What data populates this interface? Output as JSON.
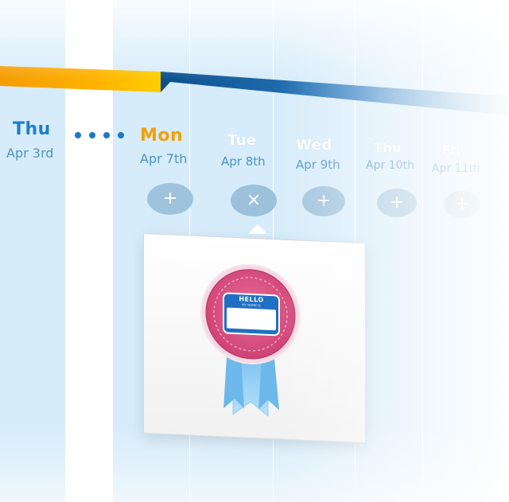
{
  "timeline": {
    "colors": {
      "orange": "#f2a10c",
      "blue": "#0f6eb0",
      "muted": "#4b95c3"
    }
  },
  "calendar": {
    "days": [
      {
        "day": "Thu",
        "date": "Apr 3rd",
        "state": "past"
      },
      {
        "day": "Mon",
        "date": "Apr 7th",
        "state": "today"
      },
      {
        "day": "Tue",
        "date": "Apr 8th",
        "state": "selected",
        "button_icon": "close-icon"
      },
      {
        "day": "Wed",
        "date": "Apr 9th",
        "state": "upcoming",
        "button_icon": "plus-icon"
      },
      {
        "day": "Thu",
        "date": "Apr 10th",
        "state": "upcoming",
        "button_icon": "plus-icon"
      },
      {
        "day": "Fri",
        "date": "Apr 11th",
        "state": "upcoming",
        "button_icon": "plus-icon"
      }
    ],
    "today_button_icon": "plus-icon",
    "plus_glyph": "+",
    "close_glyph": "×"
  },
  "popover": {
    "badge_icon": "name-tag-ribbon-icon",
    "badge_text_hello": "HELLO",
    "badge_text_sub": "MY NAME IS"
  }
}
